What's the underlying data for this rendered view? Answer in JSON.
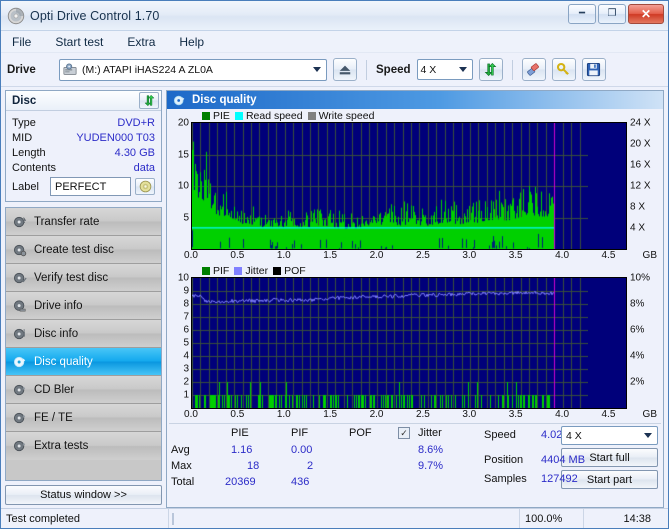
{
  "window": {
    "title": "Opti Drive Control 1.70",
    "icon": "disc-icon",
    "buttons": {
      "minimize": "—",
      "maximize": "❐",
      "close": "✕"
    }
  },
  "menu": {
    "items": [
      "File",
      "Start test",
      "Extra",
      "Help"
    ]
  },
  "toolbar": {
    "drive_label": "Drive",
    "drive_value": "(M:)  ATAPI iHAS224  A ZL0A",
    "eject_icon": "eject-icon",
    "speed_label": "Speed",
    "speed_value": "4 X",
    "refresh_icon": "refresh-icon",
    "eraser_icon": "eraser-icon",
    "key_icon": "key-icon",
    "save_icon": "save-icon"
  },
  "disc": {
    "header": "Disc",
    "refresh_icon": "refresh-icon",
    "rows": [
      {
        "key": "Type",
        "value": "DVD+R"
      },
      {
        "key": "MID",
        "value": "YUDEN000 T03"
      },
      {
        "key": "Length",
        "value": "4.30 GB"
      },
      {
        "key": "Contents",
        "value": "data"
      }
    ],
    "label_key": "Label",
    "label_value": "PERFECT",
    "label_icon": "disc-gold-icon"
  },
  "nav": {
    "items": [
      {
        "label": "Transfer rate",
        "icon": "disc-rate-icon",
        "selected": false
      },
      {
        "label": "Create test disc",
        "icon": "disc-create-icon",
        "selected": false
      },
      {
        "label": "Verify test disc",
        "icon": "disc-verify-icon",
        "selected": false
      },
      {
        "label": "Drive info",
        "icon": "drive-info-icon",
        "selected": false
      },
      {
        "label": "Disc info",
        "icon": "disc-info-icon",
        "selected": false
      },
      {
        "label": "Disc quality",
        "icon": "disc-quality-icon",
        "selected": true
      },
      {
        "label": "CD Bler",
        "icon": "cd-bler-icon",
        "selected": false
      },
      {
        "label": "FE / TE",
        "icon": "fe-te-icon",
        "selected": false
      },
      {
        "label": "Extra tests",
        "icon": "extra-tests-icon",
        "selected": false
      }
    ],
    "status_window_button": "Status window >>"
  },
  "content": {
    "header": "Disc quality",
    "header_icon": "disc-quality-icon"
  },
  "stats": {
    "col_pie": "PIE",
    "col_pif": "PIF",
    "col_pof": "POF",
    "jitter_label": "Jitter",
    "jitter_checked": true,
    "rows": [
      {
        "name": "Avg",
        "pie": "1.16",
        "pif": "0.00",
        "pof": "",
        "jitter": "8.6%"
      },
      {
        "name": "Max",
        "pie": "18",
        "pif": "2",
        "pof": "",
        "jitter": "9.7%"
      },
      {
        "name": "Total",
        "pie": "20369",
        "pif": "436",
        "pof": "",
        "jitter": ""
      }
    ],
    "speed_label": "Speed",
    "speed_value": "4.02 X",
    "position_label": "Position",
    "position_value": "4404 MB",
    "samples_label": "Samples",
    "samples_value": "127492",
    "test_speed": "4 X",
    "start_full": "Start full",
    "start_part": "Start part"
  },
  "statusbar": {
    "message": "Test completed",
    "percent": "100.0%",
    "progress": 100,
    "time": "14:38"
  },
  "colors": {
    "pie_green": "#00c000",
    "read_speed_cyan": "#00ffff",
    "write_speed_gray": "#808080",
    "pif_green": "#00b000",
    "jitter_purple": "#8080ff",
    "pof_black": "#000000",
    "plot_bg": "#00007a",
    "accent_blue": "#1d69c8"
  },
  "chart_data": [
    {
      "type": "bar",
      "title": "PIE / Read speed",
      "legend": [
        {
          "label": "PIE",
          "color": "#008000"
        },
        {
          "label": "Read speed",
          "color": "#00ffff"
        },
        {
          "label": "Write speed",
          "color": "#808080"
        }
      ],
      "xlabel": "GB",
      "x_ticks": [
        "0.0",
        "0.5",
        "1.0",
        "1.5",
        "2.0",
        "2.5",
        "3.0",
        "3.5",
        "4.0",
        "4.5"
      ],
      "xlim": [
        0,
        4.7
      ],
      "ylabel_left": "PIE",
      "y_ticks_left": [
        "20",
        "15",
        "10",
        "5"
      ],
      "ylim": [
        0,
        20
      ],
      "ylabel_right": "Speed",
      "y_ticks_right": [
        "24 X",
        "20 X",
        "16 X",
        "12 X",
        "8 X",
        "4 X"
      ],
      "ylim_right": [
        0,
        24
      ],
      "grid": true,
      "data_end_gb": 4.3,
      "read_speed_constant": 4.02,
      "pie_envelope": [
        [
          0.0,
          18
        ],
        [
          0.05,
          15.5
        ],
        [
          0.1,
          13.8
        ],
        [
          0.15,
          14.5
        ],
        [
          0.2,
          13.5
        ],
        [
          0.25,
          11.0
        ],
        [
          0.3,
          10.5
        ],
        [
          0.35,
          9.5
        ],
        [
          0.4,
          10.0
        ],
        [
          0.5,
          9.0
        ],
        [
          0.6,
          7.5
        ],
        [
          0.7,
          7.0
        ],
        [
          0.8,
          6.5
        ],
        [
          0.9,
          7.0
        ],
        [
          1.0,
          6.5
        ],
        [
          1.2,
          7.0
        ],
        [
          1.4,
          6.5
        ],
        [
          1.6,
          7.0
        ],
        [
          1.8,
          6.0
        ],
        [
          2.0,
          6.5
        ],
        [
          2.2,
          7.5
        ],
        [
          2.4,
          7.0
        ],
        [
          2.6,
          7.5
        ],
        [
          2.8,
          7.0
        ],
        [
          3.0,
          8.0
        ],
        [
          3.2,
          7.5
        ],
        [
          3.4,
          8.0
        ],
        [
          3.6,
          9.0
        ],
        [
          3.8,
          8.5
        ],
        [
          4.0,
          10.5
        ],
        [
          4.2,
          9.5
        ],
        [
          4.3,
          8.5
        ]
      ],
      "pie_avg": 1.16,
      "pie_max": 18,
      "pie_total": 20369
    },
    {
      "type": "bar",
      "title": "PIF / Jitter / POF",
      "legend": [
        {
          "label": "PIF",
          "color": "#008000"
        },
        {
          "label": "Jitter",
          "color": "#8080ff"
        },
        {
          "label": "POF",
          "color": "#000000"
        }
      ],
      "xlabel": "GB",
      "x_ticks": [
        "0.0",
        "0.5",
        "1.0",
        "1.5",
        "2.0",
        "2.5",
        "3.0",
        "3.5",
        "4.0",
        "4.5"
      ],
      "xlim": [
        0,
        4.7
      ],
      "ylabel_left": "PIF",
      "y_ticks_left": [
        "10",
        "9",
        "8",
        "7",
        "6",
        "5",
        "4",
        "3",
        "2",
        "1"
      ],
      "ylim": [
        0,
        10
      ],
      "ylabel_right": "Jitter",
      "y_ticks_right": [
        "10%",
        "8%",
        "6%",
        "4%",
        "2%"
      ],
      "ylim_right": [
        0,
        10
      ],
      "grid": true,
      "data_end_gb": 4.3,
      "jitter_curve": [
        [
          0.0,
          8.6
        ],
        [
          0.05,
          8.7
        ],
        [
          0.1,
          8.6
        ],
        [
          0.15,
          8.2
        ],
        [
          0.2,
          8.15
        ],
        [
          0.3,
          8.2
        ],
        [
          0.4,
          8.2
        ],
        [
          0.5,
          8.25
        ],
        [
          0.6,
          8.2
        ],
        [
          0.7,
          8.25
        ],
        [
          0.8,
          8.2
        ],
        [
          0.9,
          8.25
        ],
        [
          1.0,
          8.3
        ],
        [
          1.1,
          8.25
        ],
        [
          1.2,
          8.3
        ],
        [
          1.3,
          8.3
        ],
        [
          1.4,
          8.3
        ],
        [
          1.5,
          8.35
        ],
        [
          1.6,
          8.4
        ],
        [
          1.7,
          8.45
        ],
        [
          1.8,
          8.5
        ],
        [
          1.9,
          8.5
        ],
        [
          2.0,
          8.55
        ],
        [
          2.2,
          8.6
        ],
        [
          2.4,
          8.6
        ],
        [
          2.6,
          8.65
        ],
        [
          2.8,
          8.7
        ],
        [
          3.0,
          8.7
        ],
        [
          3.2,
          8.75
        ],
        [
          3.4,
          8.8
        ],
        [
          3.6,
          8.8
        ],
        [
          3.8,
          8.85
        ],
        [
          4.0,
          8.9
        ],
        [
          4.2,
          8.85
        ],
        [
          4.3,
          8.8
        ]
      ],
      "pif_avg": 0.0,
      "pif_max": 2,
      "pif_total": 436,
      "jitter_avg": "8.6%",
      "jitter_max": "9.7%"
    }
  ]
}
